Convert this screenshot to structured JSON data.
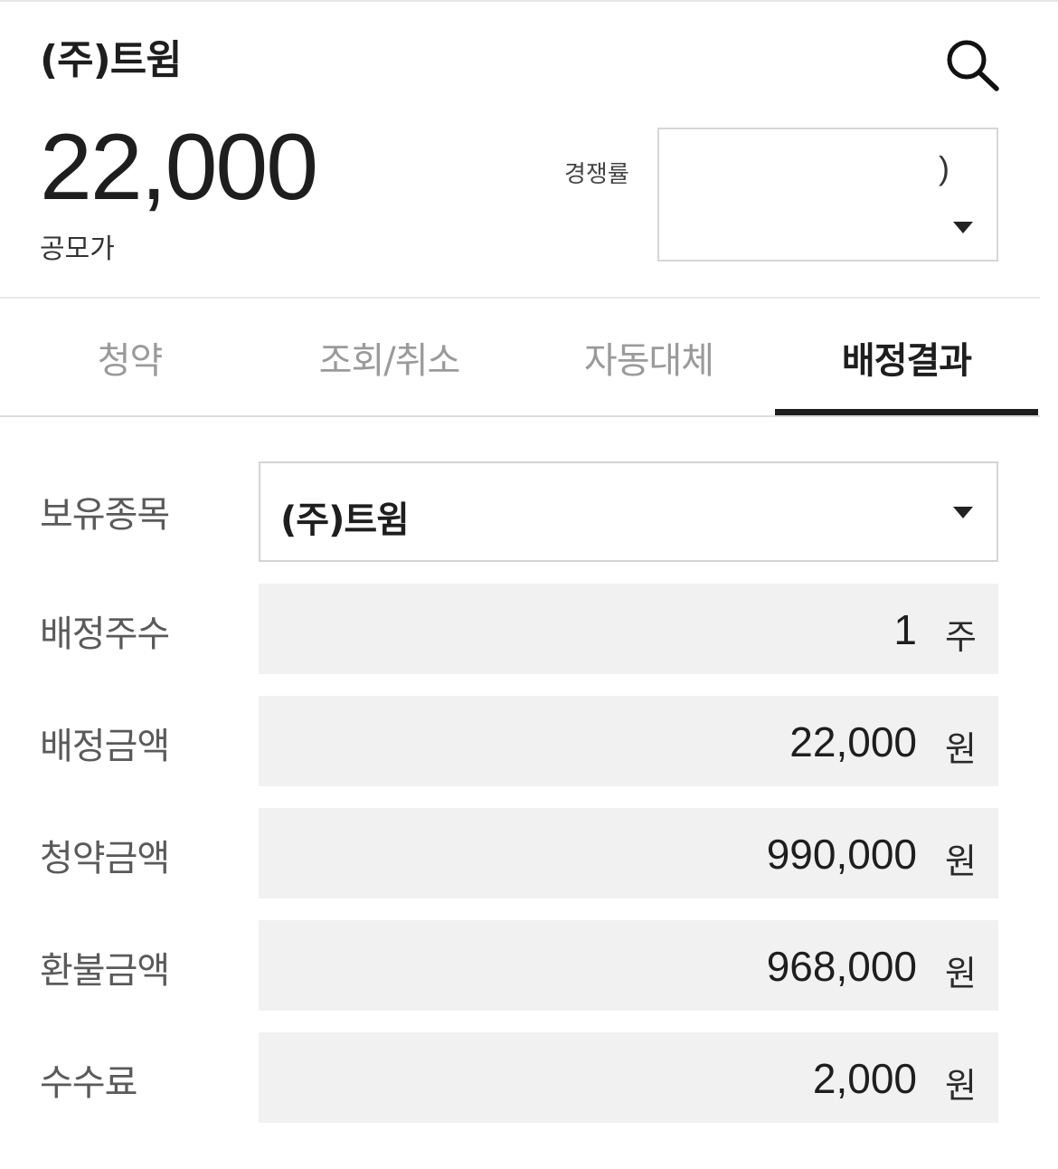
{
  "header": {
    "stock_name": "(주)트윔",
    "offer_price": "22,000",
    "offer_price_label": "공모가",
    "competition_label": "경쟁률",
    "competition_value": ")"
  },
  "tabs": [
    {
      "label": "청약",
      "active": false
    },
    {
      "label": "조회/취소",
      "active": false
    },
    {
      "label": "자동대체",
      "active": false
    },
    {
      "label": "배정결과",
      "active": true
    }
  ],
  "result": {
    "holding": {
      "label": "보유종목",
      "value": "(주)트윔"
    },
    "rows": [
      {
        "label": "배정주수",
        "value": "1",
        "unit": "주"
      },
      {
        "label": "배정금액",
        "value": "22,000",
        "unit": "원"
      },
      {
        "label": "청약금액",
        "value": "990,000",
        "unit": "원"
      },
      {
        "label": "환불금액",
        "value": "968,000",
        "unit": "원"
      },
      {
        "label": "수수료",
        "value": "2,000",
        "unit": "원"
      }
    ]
  },
  "colors": {
    "active_tab": "#1e1e1e",
    "inactive_tab": "#9a9a9a",
    "field_background": "#f1f1f1"
  },
  "icons": {
    "search": "search-icon",
    "dropdown": "chevron-down-icon"
  }
}
